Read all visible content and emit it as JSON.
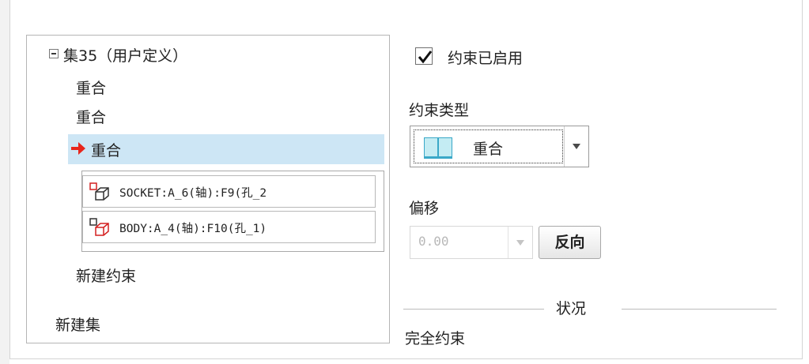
{
  "tree": {
    "set_label": "集35（用户定义）",
    "items": [
      "重合",
      "重合",
      "重合"
    ],
    "references": [
      "SOCKET:A_6(轴):F9(孔_2",
      "BODY:A_4(轴):F10(孔_1)"
    ],
    "new_constraint": "新建约束",
    "new_set": "新建集"
  },
  "constraint": {
    "enabled_label": "约束已启用",
    "enabled": true,
    "type_label": "约束类型",
    "type_value": "重合",
    "offset_label": "偏移",
    "offset_value": "0.00",
    "flip_label": "反向"
  },
  "status": {
    "group_label": "状况",
    "value": "完全约束"
  },
  "colors": {
    "selection": "#cde6f5",
    "arrow": "#e8261c",
    "type_icon_fill": "#c4ecf3",
    "type_icon_stroke": "#3aa8c8"
  }
}
